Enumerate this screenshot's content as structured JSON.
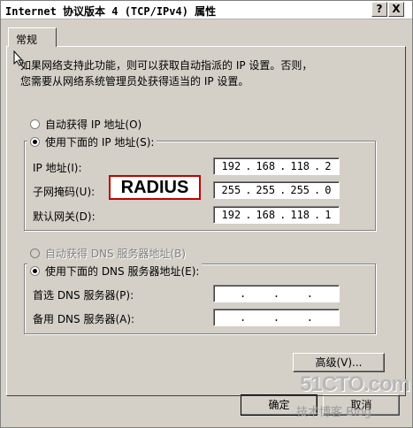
{
  "window": {
    "title": "Internet 协议版本 4 (TCP/IPv4) 属性",
    "help_button": "?",
    "close_button": "X"
  },
  "tabs": [
    {
      "label": "常规",
      "active": true
    }
  ],
  "description": {
    "line1": "如果网络支持此功能，则可以获取自动指派的 IP 设置。否则，",
    "line2": "您需要从网络系统管理员处获得适当的 IP 设置。"
  },
  "ip_settings": {
    "auto_option": "自动获得 IP 地址(O)",
    "manual_option": "使用下面的 IP 地址(S):",
    "selected": "manual",
    "ip_label": "IP 地址(I):",
    "mask_label": "子网掩码(U):",
    "gateway_label": "默认网关(D):",
    "ip_address": [
      "192",
      "168",
      "118",
      "2"
    ],
    "subnet_mask": [
      "255",
      "255",
      "255",
      "0"
    ],
    "default_gateway": [
      "192",
      "168",
      "118",
      "1"
    ]
  },
  "dns_settings": {
    "auto_option": "自动获得 DNS 服务器地址(B)",
    "manual_option": "使用下面的 DNS 服务器地址(E):",
    "selected": "manual",
    "preferred_label": "首选 DNS 服务器(P):",
    "alternate_label": "备用 DNS 服务器(A):",
    "preferred": [
      "",
      "",
      "",
      ""
    ],
    "alternate": [
      "",
      "",
      "",
      ""
    ]
  },
  "annotation": {
    "text": "RADIUS",
    "border_color": "#c00000"
  },
  "buttons": {
    "advanced": "高级(V)...",
    "ok": "确定",
    "cancel": "取消"
  },
  "watermark": {
    "main": "51CTO.com",
    "sub": "技术博客 Blog"
  },
  "colors": {
    "dialog_bg": "#d4d0c8",
    "input_bg": "#ffffff"
  }
}
